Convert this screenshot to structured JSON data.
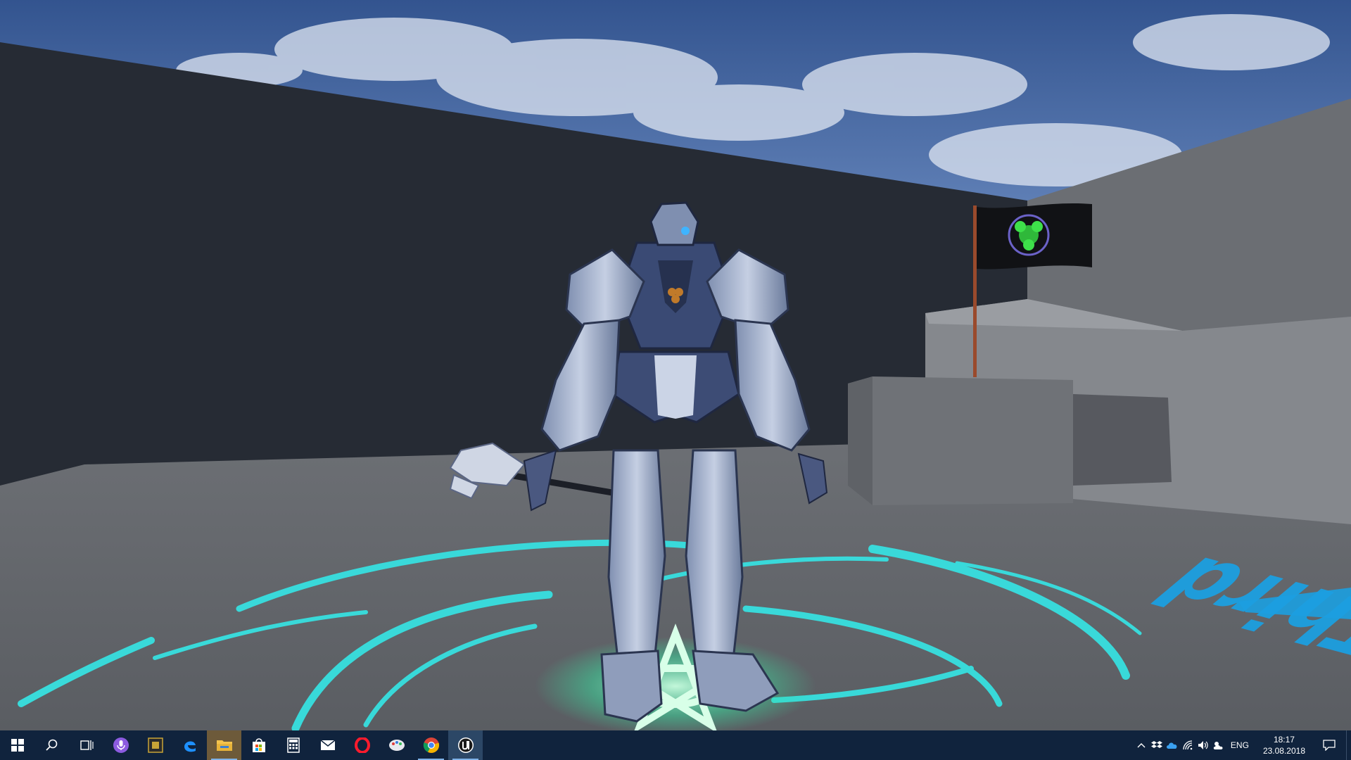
{
  "scene": {
    "floor_text": "Third",
    "floor_text_color": "#1c9fe0",
    "glow_color": "#37e0e0",
    "sky_color": "#3b5e9e",
    "wall_color": "#252a33"
  },
  "taskbar": {
    "background": "#10233d",
    "pinned": [
      {
        "name": "start-button",
        "icon": "windows-logo-icon"
      },
      {
        "name": "search-button",
        "icon": "search-icon"
      },
      {
        "name": "task-view-button",
        "icon": "task-view-icon"
      },
      {
        "name": "cortana-button",
        "icon": "microphone-icon"
      },
      {
        "name": "app-terminal-button",
        "icon": "terminal-app-icon"
      },
      {
        "name": "edge-button",
        "icon": "edge-icon"
      },
      {
        "name": "file-explorer-button",
        "icon": "folder-icon"
      },
      {
        "name": "store-button",
        "icon": "store-bag-icon"
      },
      {
        "name": "calculator-button",
        "icon": "calculator-icon"
      },
      {
        "name": "mail-button",
        "icon": "mail-icon"
      },
      {
        "name": "opera-button",
        "icon": "opera-icon"
      },
      {
        "name": "paint-button",
        "icon": "paint-icon"
      },
      {
        "name": "chrome-button",
        "icon": "chrome-icon"
      },
      {
        "name": "unreal-engine-button",
        "icon": "unreal-icon"
      }
    ],
    "tray": {
      "language": "ENG",
      "time": "18:17",
      "date": "23.08.2018"
    }
  }
}
